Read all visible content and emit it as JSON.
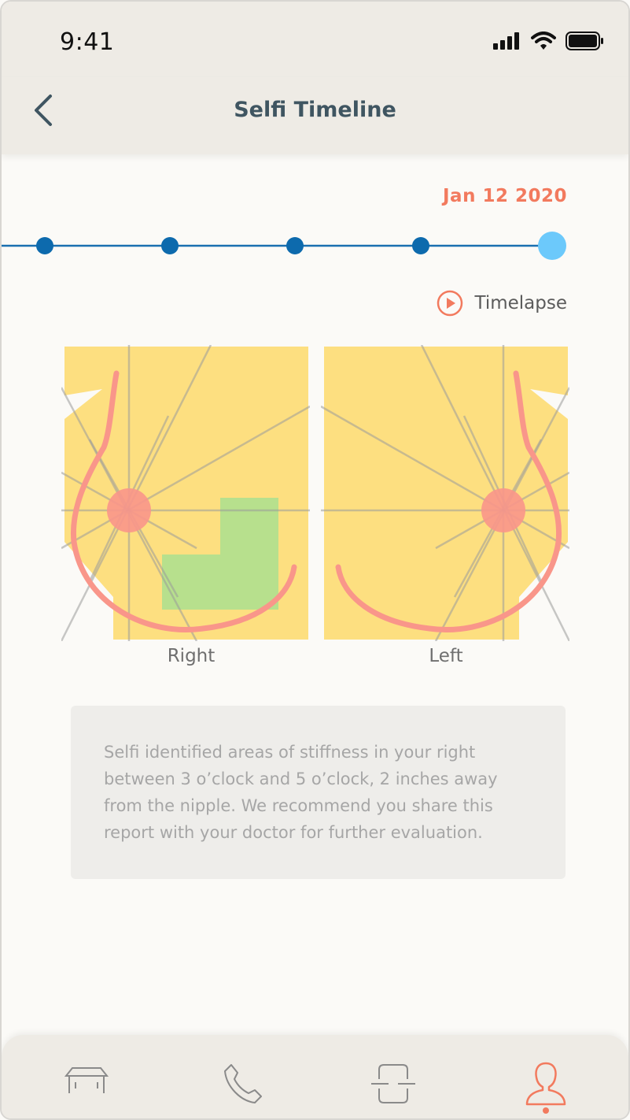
{
  "status_bar": {
    "time": "9:41"
  },
  "nav": {
    "title": "Selfi Timeline"
  },
  "timeline": {
    "selected_date": "Jan 12 2020",
    "point_count": 5,
    "selected_index": 4
  },
  "timelapse": {
    "label": "Timelapse"
  },
  "diagrams": {
    "right_label": "Right",
    "left_label": "Left"
  },
  "report": {
    "text": "Selfi identified areas of stiffness in your right between 3 o’clock and 5 o’clock, 2 inches away from the nipple. We recommend you share this report with your doctor for further evaluation."
  },
  "tabs": [
    {
      "name": "home-icon"
    },
    {
      "name": "phone-icon"
    },
    {
      "name": "scan-icon"
    },
    {
      "name": "profile-icon",
      "active": true
    }
  ],
  "colors": {
    "accent": "#f27a5e",
    "timeline_line": "#1a6fb0",
    "timeline_dot": "#0d6aad",
    "timeline_selected": "#6cc9fb",
    "body_fill": "#fddf80",
    "highlight_green": "#b7e08d",
    "outline_pink": "#f9968a",
    "nav_title": "#3f5561"
  }
}
